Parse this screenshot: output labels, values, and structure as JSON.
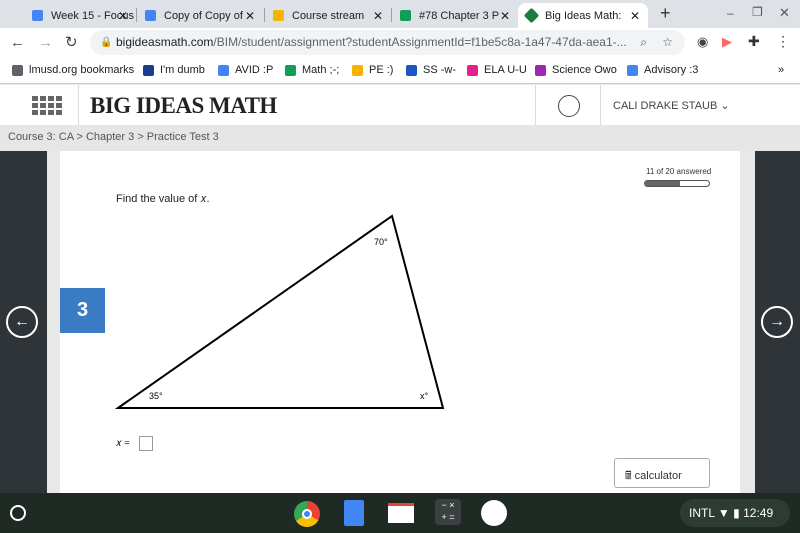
{
  "browser": {
    "tabs": [
      {
        "title": "Week 15 - Focus",
        "color": "#4285f4"
      },
      {
        "title": "Copy of Copy of",
        "color": "#4285f4"
      },
      {
        "title": "Course stream",
        "color": "#f4b400"
      },
      {
        "title": "#78 Chapter 3 P",
        "color": "#0f9d58"
      },
      {
        "title": "Big Ideas Math:",
        "color": "#1a7f3c",
        "active": true
      }
    ],
    "url_domain": "bigideasmath.com",
    "url_path": "/BIM/student/assignment?studentAssignmentId=f1be5c8a-1a47-47da-aea1-...",
    "bookmarks": [
      {
        "label": "lmusd.org bookmarks",
        "color": "#5f6368"
      },
      {
        "label": "I'm dumb",
        "color": "#1a3d8f"
      },
      {
        "label": "AVID :P",
        "color": "#4285f4"
      },
      {
        "label": "Math ;-;",
        "color": "#0f9d58"
      },
      {
        "label": "PE :)",
        "color": "#f4b400"
      },
      {
        "label": "SS -w-",
        "color": "#1a56c4"
      },
      {
        "label": "ELA U-U",
        "color": "#e91e8c"
      },
      {
        "label": "Science Owo",
        "color": "#9c27b0"
      },
      {
        "label": "Advisory :3",
        "color": "#4285f4"
      }
    ],
    "more": "»"
  },
  "app": {
    "logo": "BIG IDEAS MATH",
    "user": "CALI DRAKE STAUB",
    "breadcrumb": "Course 3: CA > Chapter 3 > Practice Test 3",
    "progress_text": "11 of 20 answered",
    "progress_fraction": 0.55,
    "question_number": "3",
    "prompt": "Find the value of 𝑥.",
    "angles": {
      "top": "70°",
      "left": "35°",
      "right": "x°"
    },
    "answer_label": "𝑥 =",
    "answer_value": "",
    "calculator": "calculator",
    "accent": "#3a7cc4"
  },
  "taskbar": {
    "lang": "INTL",
    "time": "12:49"
  }
}
